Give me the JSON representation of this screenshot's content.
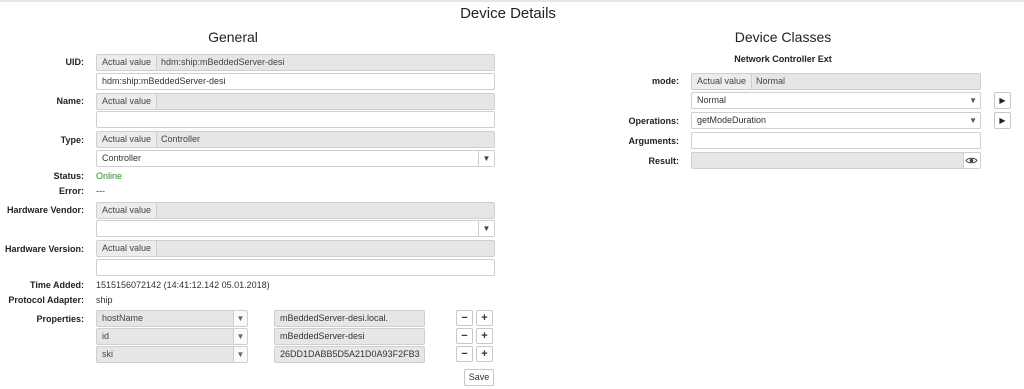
{
  "page": {
    "title": "Device Details"
  },
  "general": {
    "title": "General",
    "actual_value_label": "Actual value",
    "uid": {
      "label": "UID:",
      "actual": "hdm:ship:mBeddedServer-desi",
      "value": "hdm:ship:mBeddedServer-desi"
    },
    "name": {
      "label": "Name:",
      "actual": "",
      "value": ""
    },
    "type": {
      "label": "Type:",
      "actual": "Controller",
      "selected": "Controller"
    },
    "status": {
      "label": "Status:",
      "value": "Online",
      "color": "#2a8a2a"
    },
    "error": {
      "label": "Error:",
      "value": "---"
    },
    "hardware_vendor": {
      "label": "Hardware Vendor:",
      "actual": "",
      "selected": ""
    },
    "hardware_version": {
      "label": "Hardware Version:",
      "actual": "",
      "value": ""
    },
    "time_added": {
      "label": "Time Added:",
      "value": "1515156072142 (14:41:12.142 05.01.2018)"
    },
    "protocol_adapter": {
      "label": "Protocol Adapter:",
      "value": "ship"
    },
    "properties": {
      "label": "Properties:",
      "rows": [
        {
          "key": "hostName",
          "value": "mBeddedServer-desi.local."
        },
        {
          "key": "id",
          "value": "mBeddedServer-desi"
        },
        {
          "key": "ski",
          "value": "26DD1DABB5D5A21D0A93F2FB3"
        }
      ],
      "remove_symbol": "−",
      "add_symbol": "+"
    },
    "save_label": "Save"
  },
  "device_classes": {
    "title": "Device Classes",
    "class_name": "Network Controller Ext",
    "mode": {
      "label": "mode:",
      "actual_label": "Actual value",
      "actual": "Normal",
      "selected": "Normal"
    },
    "operations": {
      "label": "Operations:",
      "selected": "getModeDuration"
    },
    "arguments": {
      "label": "Arguments:",
      "value": ""
    },
    "result": {
      "label": "Result:",
      "value": ""
    }
  },
  "icons": {
    "play": "play-icon",
    "dropdown": "chevron-down-icon",
    "eye": "eye-icon",
    "minus": "minus-icon",
    "plus": "plus-icon"
  }
}
